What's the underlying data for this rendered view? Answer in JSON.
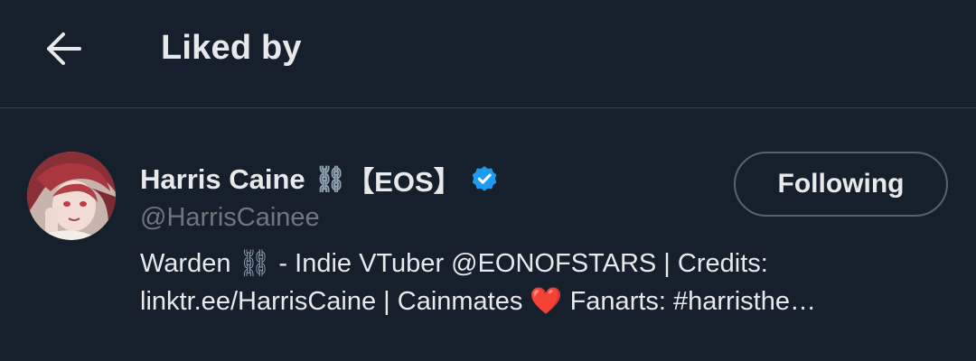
{
  "header": {
    "title": "Liked by",
    "back_icon": "arrow-left-icon"
  },
  "user": {
    "display_name": "Harris Caine",
    "name_emoji": "⛓",
    "name_tag": "【EOS】",
    "verified_icon": "verified-badge-icon",
    "handle": "@HarrisCainee",
    "follow_label": "Following",
    "bio_line1_a": "Warden ",
    "bio_line1_emoji": "⛓",
    "bio_line1_b": " - Indie VTuber @EONOFSTARS | Credits:",
    "bio_line2_a": "linktr.ee/HarrisCaine | Cainmates ",
    "bio_line2_emoji": "❤️",
    "bio_line2_b": " Fanarts: #harristhe…"
  },
  "colors": {
    "background": "#16202c",
    "text": "#e7e9ea",
    "muted": "#71767b",
    "verified": "#1d9bf0",
    "divider": "#38444d"
  }
}
